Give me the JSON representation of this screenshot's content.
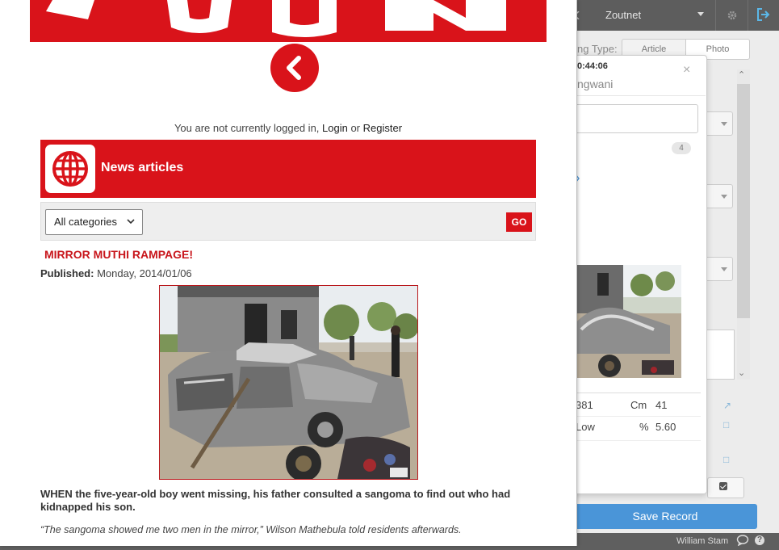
{
  "background_app": {
    "menu_label": "Zoutnet",
    "listing_type_label": "ng Type:",
    "tabs": [
      {
        "label": "Article"
      },
      {
        "label": "Photo"
      }
    ],
    "modal": {
      "time": "0:44:06",
      "name": "ngwani",
      "badge": "4",
      "stats": [
        {
          "left": "381",
          "label": "Cm",
          "value": "41"
        },
        {
          "left": "Low",
          "label": "%",
          "value": "5.60"
        }
      ]
    },
    "save_button": "Save Record",
    "footer_user": "William Stam",
    "help_glyph": "?"
  },
  "site": {
    "login_prefix": "You are not currently logged in, ",
    "login_link": "Login",
    "or_text": " or ",
    "register_link": "Register",
    "section_title": "News articles",
    "category_select": "All categories",
    "go_button": "GO",
    "article": {
      "headline": "MIRROR MUTHI RAMPAGE!",
      "published_label": "Published:",
      "published_date": "Monday, 2014/01/06",
      "lead": "WHEN the five-year-old boy went missing, his father consulted a sangoma to find out who had kidnapped his son.",
      "quote": "“The sangoma showed me two men in the mirror,” Wilson Mathebula told residents afterwards."
    }
  },
  "colors": {
    "brand_red": "#d9131a",
    "save_blue": "#4a95d8",
    "topbar_gray": "#5d5d5d"
  }
}
